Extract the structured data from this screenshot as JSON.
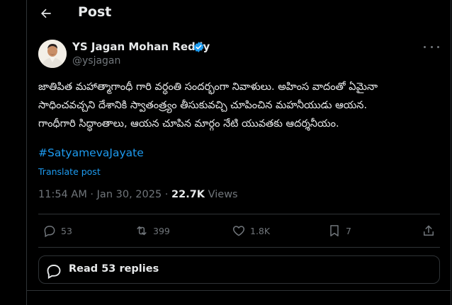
{
  "header": {
    "title": "Post"
  },
  "author": {
    "name": "YS Jagan Mohan Reddy",
    "handle": "@ysjagan"
  },
  "post": {
    "lines": [
      "జాతిపిత మహాత్మాగాంధీ గారి వర్ధంతి సందర్భంగా నివాళులు. అహింస వాదంతో ఏమైనా",
      "సాధించవచ్చని దేశానికి స్వాతంత్ర్యం తీసుకువచ్చి చూపించిన మహనీయుడు ఆయన.",
      "గాంధీగారి సిద్ధాంతాలు, ఆయన చూపిన మార్గం నేటి యువతకు ఆదర్శనీయం."
    ],
    "hashtag": "#SatyamevaJayate",
    "translate": "Translate post"
  },
  "meta": {
    "time": "11:54 AM",
    "sep": " · ",
    "date": "Jan 30, 2025",
    "views_count": "22.7K",
    "views_label": "Views"
  },
  "actions": {
    "replies": "53",
    "reposts": "399",
    "likes": "1.8K",
    "bookmarks": "7"
  },
  "read_replies": "Read 53 replies",
  "colors": {
    "accent": "#1d9bf0",
    "secondary_text": "#71767b",
    "border": "#2f3336",
    "background": "#000000"
  }
}
